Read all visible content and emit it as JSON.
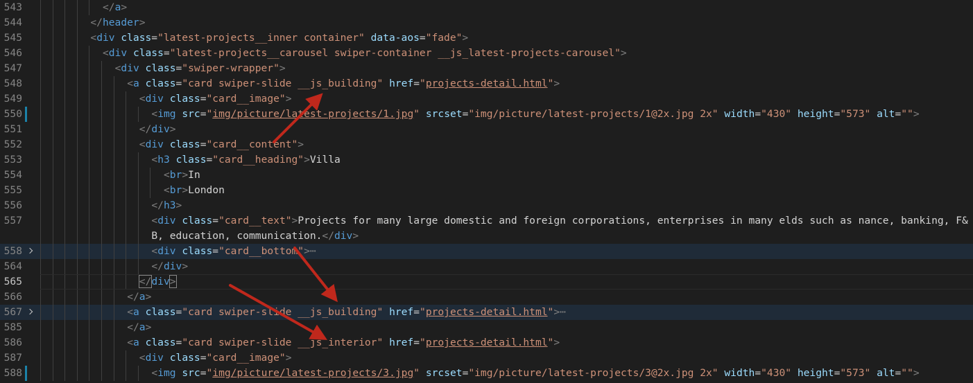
{
  "editor": {
    "lines": [
      {
        "num": "543",
        "indent": 5,
        "tokens": [
          [
            "punc",
            "</"
          ],
          [
            "tag",
            "a"
          ],
          [
            "punc",
            ">"
          ]
        ]
      },
      {
        "num": "544",
        "indent": 4,
        "tokens": [
          [
            "punc",
            "</"
          ],
          [
            "tag",
            "header"
          ],
          [
            "punc",
            ">"
          ]
        ]
      },
      {
        "num": "545",
        "indent": 4,
        "tokens": [
          [
            "punc",
            "<"
          ],
          [
            "tag",
            "div"
          ],
          [
            "txt",
            " "
          ],
          [
            "attr",
            "class"
          ],
          [
            "eq",
            "="
          ],
          [
            "str",
            "\"latest-projects__inner container\""
          ],
          [
            "txt",
            " "
          ],
          [
            "attr",
            "data-aos"
          ],
          [
            "eq",
            "="
          ],
          [
            "str",
            "\"fade\""
          ],
          [
            "punc",
            ">"
          ]
        ]
      },
      {
        "num": "546",
        "indent": 5,
        "tokens": [
          [
            "punc",
            "<"
          ],
          [
            "tag",
            "div"
          ],
          [
            "txt",
            " "
          ],
          [
            "attr",
            "class"
          ],
          [
            "eq",
            "="
          ],
          [
            "str",
            "\"latest-projects__carousel swiper-container __js_latest-projects-carousel\""
          ],
          [
            "punc",
            ">"
          ]
        ]
      },
      {
        "num": "547",
        "indent": 6,
        "tokens": [
          [
            "punc",
            "<"
          ],
          [
            "tag",
            "div"
          ],
          [
            "txt",
            " "
          ],
          [
            "attr",
            "class"
          ],
          [
            "eq",
            "="
          ],
          [
            "str",
            "\"swiper-wrapper\""
          ],
          [
            "punc",
            ">"
          ]
        ]
      },
      {
        "num": "548",
        "indent": 7,
        "tokens": [
          [
            "punc",
            "<"
          ],
          [
            "tag",
            "a"
          ],
          [
            "txt",
            " "
          ],
          [
            "attr",
            "class"
          ],
          [
            "eq",
            "="
          ],
          [
            "str",
            "\"card swiper-slide __js_building\""
          ],
          [
            "txt",
            " "
          ],
          [
            "attr",
            "href"
          ],
          [
            "eq",
            "="
          ],
          [
            "str",
            "\""
          ],
          [
            "link",
            "projects-detail.html"
          ],
          [
            "str",
            "\""
          ],
          [
            "punc",
            ">"
          ]
        ]
      },
      {
        "num": "549",
        "indent": 8,
        "tokens": [
          [
            "punc",
            "<"
          ],
          [
            "tag",
            "div"
          ],
          [
            "txt",
            " "
          ],
          [
            "attr",
            "class"
          ],
          [
            "eq",
            "="
          ],
          [
            "str",
            "\"card__image\""
          ],
          [
            "punc",
            ">"
          ]
        ]
      },
      {
        "num": "550",
        "indent": 9,
        "mod": true,
        "tokens": [
          [
            "punc",
            "<"
          ],
          [
            "tag",
            "img"
          ],
          [
            "txt",
            " "
          ],
          [
            "attr",
            "src"
          ],
          [
            "eq",
            "="
          ],
          [
            "str",
            "\""
          ],
          [
            "link",
            "img/picture/latest-projects/1.jpg"
          ],
          [
            "str",
            "\""
          ],
          [
            "txt",
            " "
          ],
          [
            "attr",
            "srcset"
          ],
          [
            "eq",
            "="
          ],
          [
            "str",
            "\"img/picture/latest-projects/1@2x.jpg 2x\""
          ],
          [
            "txt",
            " "
          ],
          [
            "attr",
            "width"
          ],
          [
            "eq",
            "="
          ],
          [
            "str",
            "\"430\""
          ],
          [
            "txt",
            " "
          ],
          [
            "attr",
            "height"
          ],
          [
            "eq",
            "="
          ],
          [
            "str",
            "\"573\""
          ],
          [
            "txt",
            " "
          ],
          [
            "attr",
            "alt"
          ],
          [
            "eq",
            "="
          ],
          [
            "str",
            "\"\""
          ],
          [
            "punc",
            ">"
          ]
        ]
      },
      {
        "num": "551",
        "indent": 8,
        "tokens": [
          [
            "punc",
            "</"
          ],
          [
            "tag",
            "div"
          ],
          [
            "punc",
            ">"
          ]
        ]
      },
      {
        "num": "552",
        "indent": 8,
        "tokens": [
          [
            "punc",
            "<"
          ],
          [
            "tag",
            "div"
          ],
          [
            "txt",
            " "
          ],
          [
            "attr",
            "class"
          ],
          [
            "eq",
            "="
          ],
          [
            "str",
            "\"card__content\""
          ],
          [
            "punc",
            ">"
          ]
        ]
      },
      {
        "num": "553",
        "indent": 9,
        "tokens": [
          [
            "punc",
            "<"
          ],
          [
            "tag",
            "h3"
          ],
          [
            "txt",
            " "
          ],
          [
            "attr",
            "class"
          ],
          [
            "eq",
            "="
          ],
          [
            "str",
            "\"card__heading\""
          ],
          [
            "punc",
            ">"
          ],
          [
            "txt",
            "Villa"
          ]
        ]
      },
      {
        "num": "554",
        "indent": 10,
        "tokens": [
          [
            "punc",
            "<"
          ],
          [
            "tag",
            "br"
          ],
          [
            "punc",
            ">"
          ],
          [
            "txt",
            "In"
          ]
        ]
      },
      {
        "num": "555",
        "indent": 10,
        "tokens": [
          [
            "punc",
            "<"
          ],
          [
            "tag",
            "br"
          ],
          [
            "punc",
            ">"
          ],
          [
            "txt",
            "London"
          ]
        ]
      },
      {
        "num": "556",
        "indent": 9,
        "tokens": [
          [
            "punc",
            "</"
          ],
          [
            "tag",
            "h3"
          ],
          [
            "punc",
            ">"
          ]
        ]
      },
      {
        "num": "557",
        "indent": 9,
        "tokens": [
          [
            "punc",
            "<"
          ],
          [
            "tag",
            "div"
          ],
          [
            "txt",
            " "
          ],
          [
            "attr",
            "class"
          ],
          [
            "eq",
            "="
          ],
          [
            "str",
            "\"card__text\""
          ],
          [
            "punc",
            ">"
          ],
          [
            "txt",
            "Projects for many large domestic and foreign corporations, enterprises in many elds such as nance, banking, F&"
          ]
        ]
      },
      {
        "num": "",
        "indent": 9,
        "tokens": [
          [
            "txt",
            "B, education, communication."
          ],
          [
            "punc",
            "</"
          ],
          [
            "tag",
            "div"
          ],
          [
            "punc",
            ">"
          ]
        ]
      },
      {
        "num": "558",
        "indent": 9,
        "fold": true,
        "hl": true,
        "tokens": [
          [
            "punc",
            "<"
          ],
          [
            "tag",
            "div"
          ],
          [
            "txt",
            " "
          ],
          [
            "attr",
            "class"
          ],
          [
            "eq",
            "="
          ],
          [
            "str",
            "\"card__bottom\""
          ],
          [
            "punc",
            ">"
          ],
          [
            "ell",
            "⋯"
          ]
        ]
      },
      {
        "num": "564",
        "indent": 9,
        "tokens": [
          [
            "punc",
            "</"
          ],
          [
            "tag",
            "div"
          ],
          [
            "punc",
            ">"
          ]
        ]
      },
      {
        "num": "565",
        "indent": 8,
        "active": true,
        "cur": true,
        "tokens": [
          [
            "punc",
            "</"
          ],
          [
            "tag",
            "div"
          ],
          [
            "punc",
            ">"
          ]
        ]
      },
      {
        "num": "566",
        "indent": 7,
        "tokens": [
          [
            "punc",
            "</"
          ],
          [
            "tag",
            "a"
          ],
          [
            "punc",
            ">"
          ]
        ]
      },
      {
        "num": "567",
        "indent": 7,
        "fold": true,
        "hl": true,
        "tokens": [
          [
            "punc",
            "<"
          ],
          [
            "tag",
            "a"
          ],
          [
            "txt",
            " "
          ],
          [
            "attr",
            "class"
          ],
          [
            "eq",
            "="
          ],
          [
            "str",
            "\"card swiper-slide __js_building\""
          ],
          [
            "txt",
            " "
          ],
          [
            "attr",
            "href"
          ],
          [
            "eq",
            "="
          ],
          [
            "str",
            "\""
          ],
          [
            "link",
            "projects-detail.html"
          ],
          [
            "str",
            "\""
          ],
          [
            "punc",
            ">"
          ],
          [
            "ell",
            "⋯"
          ]
        ]
      },
      {
        "num": "585",
        "indent": 7,
        "tokens": [
          [
            "punc",
            "</"
          ],
          [
            "tag",
            "a"
          ],
          [
            "punc",
            ">"
          ]
        ]
      },
      {
        "num": "586",
        "indent": 7,
        "tokens": [
          [
            "punc",
            "<"
          ],
          [
            "tag",
            "a"
          ],
          [
            "txt",
            " "
          ],
          [
            "attr",
            "class"
          ],
          [
            "eq",
            "="
          ],
          [
            "str",
            "\"card swiper-slide __js_interior\""
          ],
          [
            "txt",
            " "
          ],
          [
            "attr",
            "href"
          ],
          [
            "eq",
            "="
          ],
          [
            "str",
            "\""
          ],
          [
            "link",
            "projects-detail.html"
          ],
          [
            "str",
            "\""
          ],
          [
            "punc",
            ">"
          ]
        ]
      },
      {
        "num": "587",
        "indent": 8,
        "tokens": [
          [
            "punc",
            "<"
          ],
          [
            "tag",
            "div"
          ],
          [
            "txt",
            " "
          ],
          [
            "attr",
            "class"
          ],
          [
            "eq",
            "="
          ],
          [
            "str",
            "\"card__image\""
          ],
          [
            "punc",
            ">"
          ]
        ]
      },
      {
        "num": "588",
        "indent": 9,
        "mod": true,
        "tokens": [
          [
            "punc",
            "<"
          ],
          [
            "tag",
            "img"
          ],
          [
            "txt",
            " "
          ],
          [
            "attr",
            "src"
          ],
          [
            "eq",
            "="
          ],
          [
            "str",
            "\""
          ],
          [
            "link",
            "img/picture/latest-projects/3.jpg"
          ],
          [
            "str",
            "\""
          ],
          [
            "txt",
            " "
          ],
          [
            "attr",
            "srcset"
          ],
          [
            "eq",
            "="
          ],
          [
            "str",
            "\"img/picture/latest-projects/3@2x.jpg 2x\""
          ],
          [
            "txt",
            " "
          ],
          [
            "attr",
            "width"
          ],
          [
            "eq",
            "="
          ],
          [
            "str",
            "\"430\""
          ],
          [
            "txt",
            " "
          ],
          [
            "attr",
            "height"
          ],
          [
            "eq",
            "="
          ],
          [
            "str",
            "\"573\""
          ],
          [
            "txt",
            " "
          ],
          [
            "attr",
            "alt"
          ],
          [
            "eq",
            "="
          ],
          [
            "str",
            "\"\""
          ],
          [
            "punc",
            ">"
          ]
        ]
      }
    ]
  },
  "annotation_color": "#c0281c"
}
